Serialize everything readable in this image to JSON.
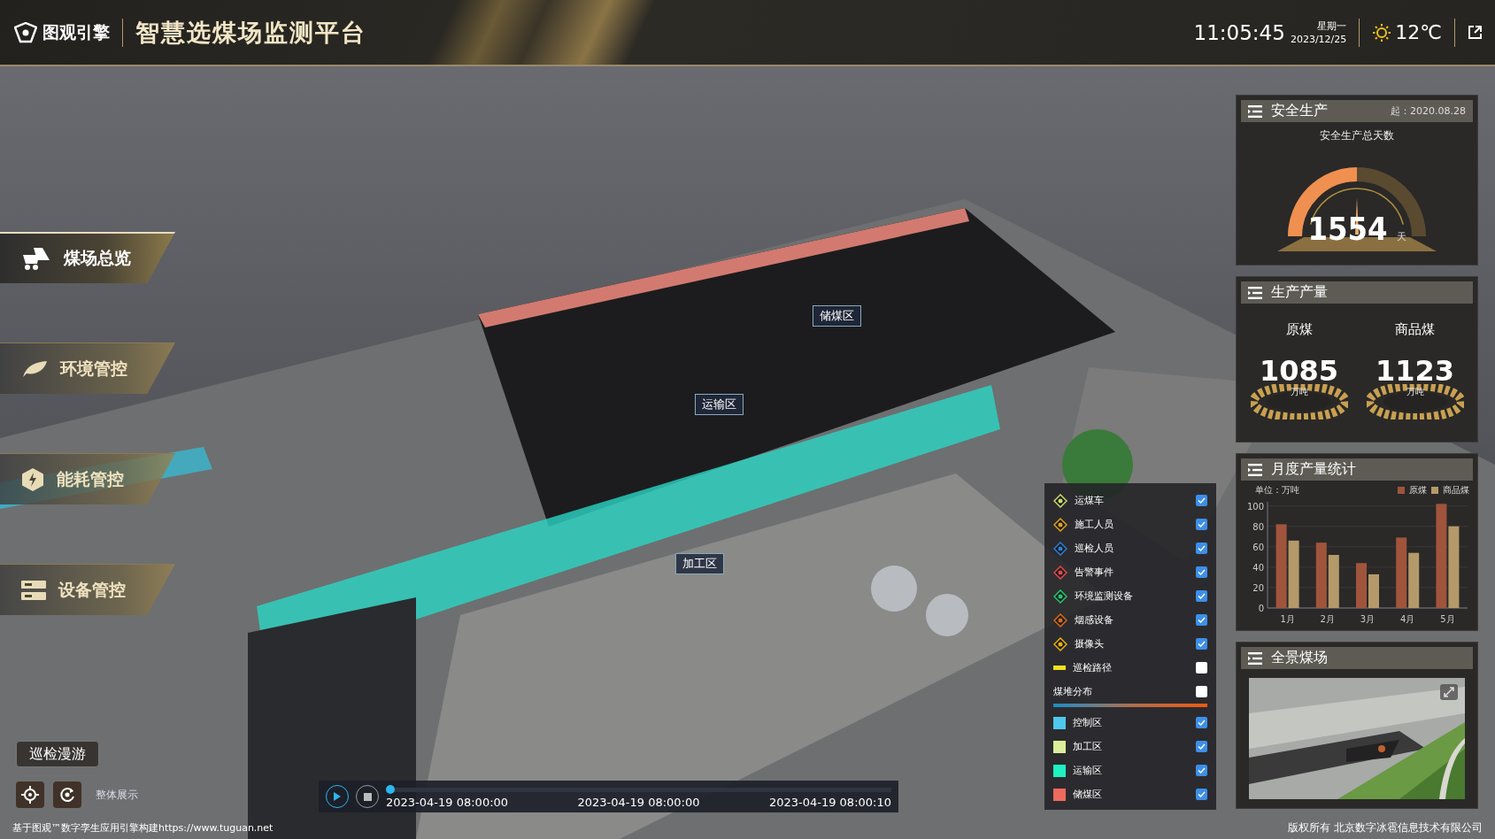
{
  "header": {
    "logo_text": "图观引擎",
    "title": "智慧选煤场监测平台",
    "time": "11:05:45",
    "weekday": "星期一",
    "date": "2023/12/25",
    "temperature": "12℃"
  },
  "nav": {
    "items": [
      {
        "label": "煤场总览",
        "selected": true
      },
      {
        "label": "环境管控",
        "selected": false
      },
      {
        "label": "能耗管控",
        "selected": false
      },
      {
        "label": "设备管控",
        "selected": false
      }
    ]
  },
  "tour_button": "巡检漫游",
  "overview_label": "整体展示",
  "map_labels": [
    {
      "label": "储煤区"
    },
    {
      "label": "运输区"
    },
    {
      "label": "加工区"
    }
  ],
  "timeline": {
    "level": 0,
    "ticks": [
      "2023-04-19 08:00:00",
      "2023-04-19 08:00:00",
      "2023-04-19 08:00:10"
    ]
  },
  "legend": {
    "items": [
      {
        "kind": "marker",
        "label": "运煤车",
        "color": "#c8dc6a",
        "checked": true
      },
      {
        "kind": "marker",
        "label": "施工人员",
        "color": "#e0a020",
        "checked": true
      },
      {
        "kind": "marker",
        "label": "巡检人员",
        "color": "#2a7fd8",
        "checked": true
      },
      {
        "kind": "marker",
        "label": "告警事件",
        "color": "#e04848",
        "checked": true
      },
      {
        "kind": "marker",
        "label": "环境监测设备",
        "color": "#20c870",
        "checked": true
      },
      {
        "kind": "marker",
        "label": "烟感设备",
        "color": "#d86a18",
        "checked": true
      },
      {
        "kind": "marker",
        "label": "摄像头",
        "color": "#e8b010",
        "checked": true
      },
      {
        "kind": "line",
        "label": "巡检路径",
        "color": "#f0e020",
        "checked": false
      },
      {
        "kind": "gradient",
        "label": "煤堆分布",
        "checked": false
      },
      {
        "kind": "area",
        "label": "控制区",
        "color": "#4fc8ee",
        "checked": true
      },
      {
        "kind": "area",
        "label": "加工区",
        "color": "#dcee99",
        "checked": true
      },
      {
        "kind": "area",
        "label": "运输区",
        "color": "#1ef2c0",
        "checked": true
      },
      {
        "kind": "area",
        "label": "储煤区",
        "color": "#ee6a5c",
        "checked": true
      }
    ]
  },
  "safety": {
    "title": "安全生产",
    "since": "起：2020.08.28",
    "subtitle": "安全生产总天数",
    "value": "1554",
    "unit": "天"
  },
  "production": {
    "title": "生产产量",
    "items": [
      {
        "label": "原煤",
        "value": "1085",
        "unit": "万吨"
      },
      {
        "label": "商品煤",
        "value": "1123",
        "unit": "万吨"
      }
    ]
  },
  "monthly": {
    "title": "月度产量统计",
    "unit_label": "单位：万吨",
    "chart_data": {
      "type": "bar",
      "categories": [
        "1月",
        "2月",
        "3月",
        "4月",
        "5月"
      ],
      "series": [
        {
          "name": "原煤",
          "color": "#a0543c",
          "values": [
            82,
            64,
            44,
            69,
            102
          ]
        },
        {
          "name": "商品煤",
          "color": "#b49a6a",
          "values": [
            66,
            52,
            33,
            54,
            80
          ]
        }
      ],
      "ylim": [
        0,
        104
      ],
      "yticks": [
        0,
        20,
        40,
        60,
        80,
        100
      ],
      "grid": true
    }
  },
  "panorama": {
    "title": "全景煤场"
  },
  "footer": {
    "left": "基于图观™数字孪生应用引擎构建https://www.tuguan.net",
    "right": "版权所有 北京数字冰雹信息技术有限公司"
  }
}
